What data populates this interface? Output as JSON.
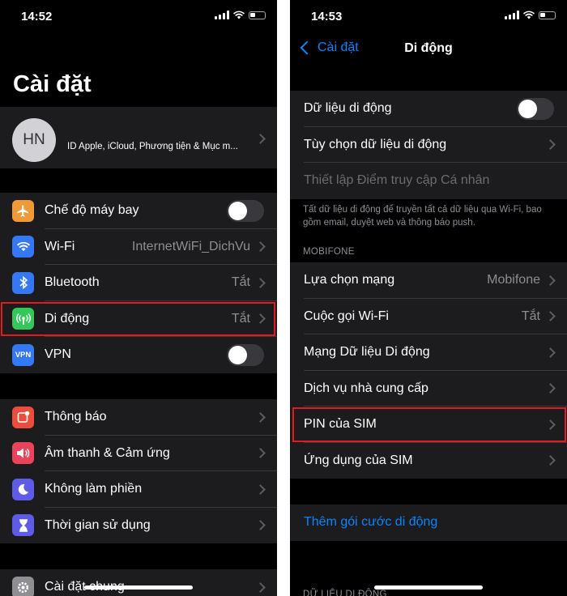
{
  "left": {
    "status_time": "14:52",
    "title": "Cài đặt",
    "profile": {
      "initials": "HN",
      "subtitle": "ID Apple, iCloud, Phương tiện & Mục m..."
    },
    "group1": [
      {
        "label": "Chế độ máy bay",
        "value": "",
        "toggle": "off",
        "icon": "airplane-icon",
        "color": "#f09a37"
      },
      {
        "label": "Wi-Fi",
        "value": "InternetWiFi_DichVu",
        "icon": "wifi-icon",
        "color": "#3478f6"
      },
      {
        "label": "Bluetooth",
        "value": "Tắt",
        "icon": "bluetooth-icon",
        "color": "#3478f6"
      },
      {
        "label": "Di động",
        "value": "Tắt",
        "icon": "cellular-antenna-icon",
        "color": "#34c759"
      },
      {
        "label": "VPN",
        "value": "",
        "toggle": "off",
        "icon": "vpn-icon",
        "color": "#3478f6",
        "icon_text": "VPN"
      }
    ],
    "group2": [
      {
        "label": "Thông báo",
        "icon": "notification-icon",
        "color": "#eb4d3d"
      },
      {
        "label": "Âm thanh & Cảm ứng",
        "icon": "speaker-icon",
        "color": "#eb445a"
      },
      {
        "label": "Không làm phiền",
        "icon": "moon-icon",
        "color": "#5e5ce6"
      },
      {
        "label": "Thời gian sử dụng",
        "icon": "hourglass-icon",
        "color": "#5e5ce6"
      }
    ],
    "group3": [
      {
        "label": "Cài đặt chung",
        "icon": "gear-icon",
        "color": "#8e8e93"
      }
    ]
  },
  "right": {
    "status_time": "14:53",
    "back_label": "Cài đặt",
    "nav_title": "Di động",
    "group1": [
      {
        "label": "Dữ liệu di động",
        "toggle": "off"
      },
      {
        "label": "Tùy chọn dữ liệu di động"
      },
      {
        "label": "Thiết lập Điểm truy cập Cá nhân",
        "disabled": true
      }
    ],
    "footer_note": "Tất dữ liệu di động để truyền tất cả dữ liệu qua Wi-Fi, bao gồm email, duyệt web và thông báo push.",
    "section_header": "MOBIFONE",
    "group2": [
      {
        "label": "Lựa chọn mạng",
        "value": "Mobifone"
      },
      {
        "label": "Cuộc gọi Wi-Fi",
        "value": "Tắt"
      },
      {
        "label": "Mạng Dữ liệu Di động",
        "value": ""
      },
      {
        "label": "Dịch vụ nhà cung cấp",
        "value": ""
      },
      {
        "label": "PIN của SIM",
        "value": ""
      },
      {
        "label": "Ứng dụng của SIM",
        "value": ""
      }
    ],
    "link_label": "Thêm gói cước di động",
    "bottom_header": "DỮ LIỆU DI ĐỘNG"
  },
  "colors": {
    "accent": "#0a84ff",
    "highlight": "#e21b23",
    "cell_bg": "#1c1c1e"
  }
}
